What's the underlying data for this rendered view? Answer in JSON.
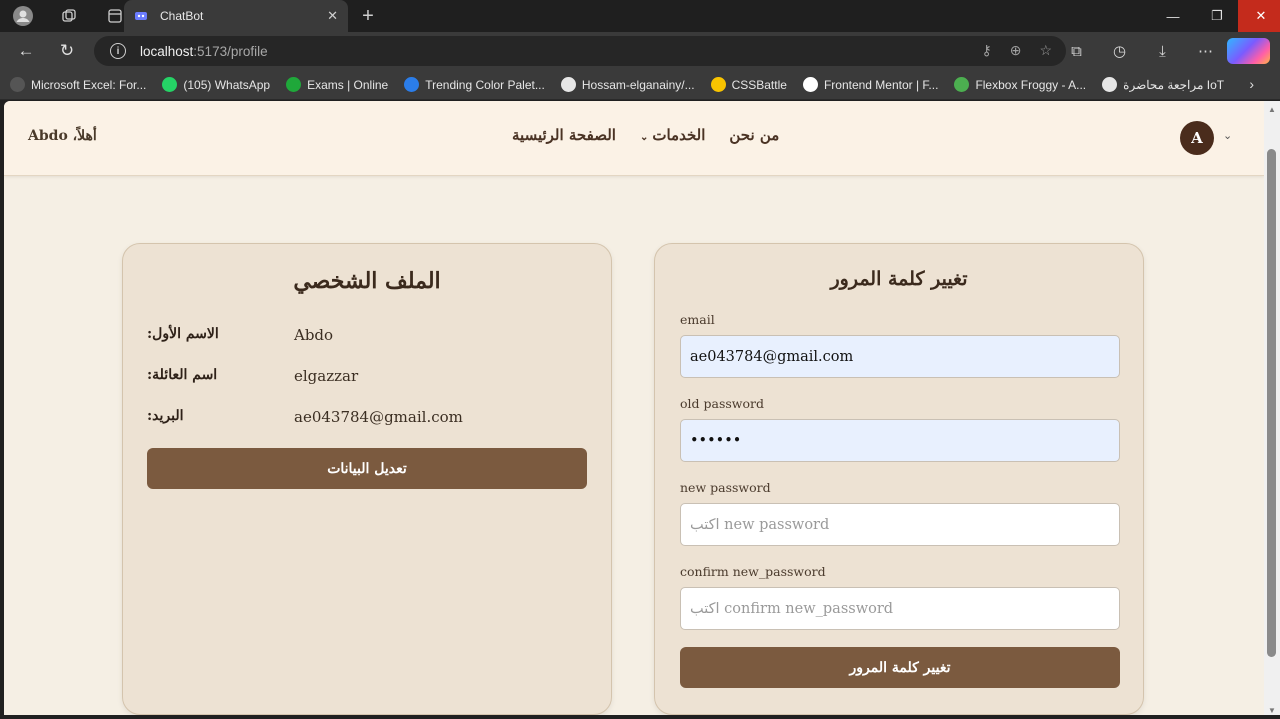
{
  "browser": {
    "tab_title": "ChatBot",
    "url_host": "localhost",
    "url_path": ":5173/profile",
    "bookmarks": [
      {
        "label": "Microsoft Excel: For...",
        "icon": "globe-icon",
        "color": "#555555"
      },
      {
        "label": "(105) WhatsApp",
        "icon": "whatsapp-icon",
        "color": "#25d366"
      },
      {
        "label": "Exams | Online",
        "icon": "check-icon",
        "color": "#1fa83a"
      },
      {
        "label": "Trending Color Palet...",
        "icon": "color-icon",
        "color": "#2b7de9"
      },
      {
        "label": "Hossam-elganainy/...",
        "icon": "github-icon",
        "color": "#e6e6e6"
      },
      {
        "label": "CSSBattle",
        "icon": "cssbattle-icon",
        "color": "#f9c400"
      },
      {
        "label": "Frontend Mentor | F...",
        "icon": "fm-icon",
        "color": "#ffffff"
      },
      {
        "label": "Flexbox Froggy - A...",
        "icon": "frog-icon",
        "color": "#4caf50"
      },
      {
        "label": "مراجعة محاضرة IoT",
        "icon": "doc-icon",
        "color": "#e6e6e6"
      }
    ]
  },
  "header": {
    "greeting": "أهلاً، Abdo",
    "nav": {
      "about": "من نحن",
      "services": "الخدمات",
      "home": "الصفحة الرئيسية"
    },
    "avatar_letter": "A"
  },
  "profile": {
    "title": "الملف الشخصي",
    "first_name_label": "الاسم الأول:",
    "first_name": "Abdo",
    "last_name_label": "اسم العائلة:",
    "last_name": "elgazzar",
    "email_label": "البريد:",
    "email": "ae043784@gmail.com",
    "edit_button": "تعديل البيانات"
  },
  "password": {
    "title": "تغيير كلمة المرور",
    "email_label": "email",
    "email_value": "ae043784@gmail.com",
    "old_label": "old password",
    "old_value": "••••••",
    "new_label": "new password",
    "new_placeholder": "اكتب new password",
    "confirm_label": "confirm new_password",
    "confirm_placeholder": "اكتب confirm new_password",
    "submit_button": "تغيير كلمة المرور"
  }
}
